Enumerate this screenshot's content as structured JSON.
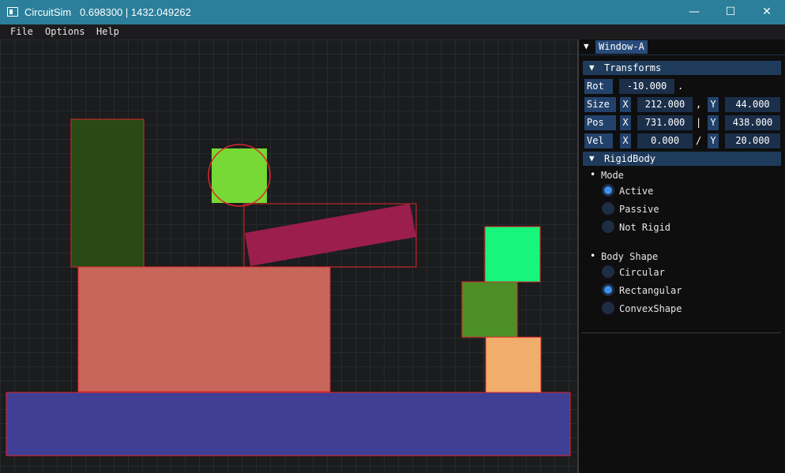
{
  "app": {
    "title": "CircuitSim   0.698300 | 1432.049262",
    "controls": {
      "minimize": "—",
      "maximize": "☐",
      "close": "✕"
    }
  },
  "menu": [
    "File",
    "Options",
    "Help"
  ],
  "panel": {
    "window_title": "Window-A",
    "transforms": {
      "header": "Transforms",
      "rot": {
        "label": "Rot",
        "value": "-10.000",
        "suffix": "."
      },
      "size": {
        "label": "Size",
        "x_axis": "X",
        "x": "212.000",
        "sep": ",",
        "y_axis": "Y",
        "y": "44.000"
      },
      "pos": {
        "label": "Pos",
        "x_axis": "X",
        "x": "731.000",
        "sep": "|",
        "y_axis": "Y",
        "y": "438.000"
      },
      "vel": {
        "label": "Vel",
        "x_axis": "X",
        "x": "0.000",
        "sep": "/",
        "y_axis": "Y",
        "y": "20.000"
      }
    },
    "rigidbody": {
      "header": "RigidBody",
      "mode": {
        "label": "Mode",
        "options": [
          "Active",
          "Passive",
          "Not Rigid"
        ],
        "selected": "Active"
      },
      "shape": {
        "label": "Body Shape",
        "options": [
          "Circular",
          "Rectangular",
          "ConvexShape"
        ],
        "selected": "Rectangular"
      }
    }
  },
  "scene": {
    "outline_color": "#e0262a",
    "bodies": [
      {
        "name": "tall-dark-green-box",
        "color": "#2a4a15"
      },
      {
        "name": "lime-square",
        "color": "#76d935"
      },
      {
        "name": "crimson-plank",
        "color": "#9c1e4a"
      },
      {
        "name": "salmon-block",
        "color": "#c8665c"
      },
      {
        "name": "mint-square",
        "color": "#17f57c"
      },
      {
        "name": "olive-square",
        "color": "#4d8f27"
      },
      {
        "name": "orange-square",
        "color": "#f0ad6c"
      },
      {
        "name": "ground-slab",
        "color": "#3f3f95"
      }
    ]
  }
}
